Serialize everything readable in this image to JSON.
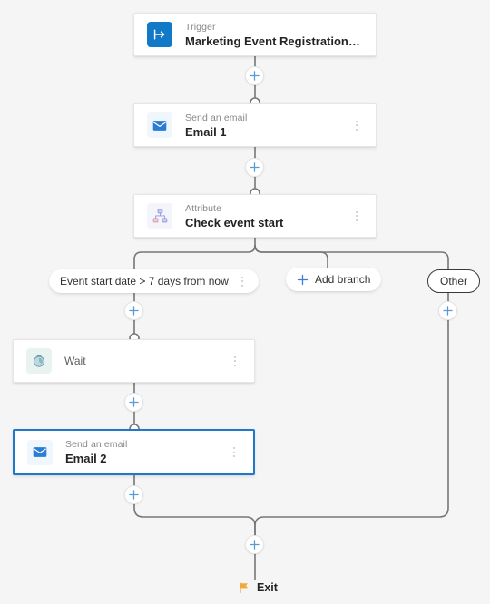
{
  "canvas": {
    "background": "#f5f5f5",
    "accent": "#1f78c8",
    "wire_color": "#767676"
  },
  "nodes": [
    {
      "id": "trigger",
      "kind": "Trigger",
      "title": "Marketing Event Registration Created",
      "icon": "trigger-arrow-icon",
      "icon_bg": "#1278c8",
      "has_kebab": false,
      "selected": false
    },
    {
      "id": "email1",
      "kind": "Send an email",
      "title": "Email 1",
      "icon": "envelope-icon",
      "icon_bg": "#eff6fc",
      "has_kebab": true,
      "selected": false
    },
    {
      "id": "attribute",
      "kind": "Attribute",
      "title": "Check event start",
      "icon": "hierarchy-icon",
      "icon_bg": "#f4f4fb",
      "has_kebab": true,
      "selected": false
    },
    {
      "id": "wait",
      "kind": "",
      "title": "Wait",
      "icon": "timer-icon",
      "icon_bg": "#e9f3f1",
      "has_kebab": true,
      "selected": false
    },
    {
      "id": "email2",
      "kind": "Send an email",
      "title": "Email 2",
      "icon": "envelope-icon",
      "icon_bg": "#eff6fc",
      "has_kebab": true,
      "selected": true
    }
  ],
  "branches": {
    "condition_label": "Event start date > 7 days from now",
    "add_branch_label": "Add branch",
    "other_label": "Other"
  },
  "exit": {
    "label": "Exit",
    "icon": "flag-icon",
    "icon_color": "#f2a73b"
  },
  "plus_buttons": [
    {
      "id": "plus-after-trigger",
      "tooltip": "Add step"
    },
    {
      "id": "plus-after-email1",
      "tooltip": "Add step"
    },
    {
      "id": "plus-branch-left-top",
      "tooltip": "Add step"
    },
    {
      "id": "plus-branch-other-top",
      "tooltip": "Add step"
    },
    {
      "id": "plus-after-wait",
      "tooltip": "Add step"
    },
    {
      "id": "plus-after-email2",
      "tooltip": "Add step"
    },
    {
      "id": "plus-before-exit",
      "tooltip": "Add step"
    }
  ]
}
